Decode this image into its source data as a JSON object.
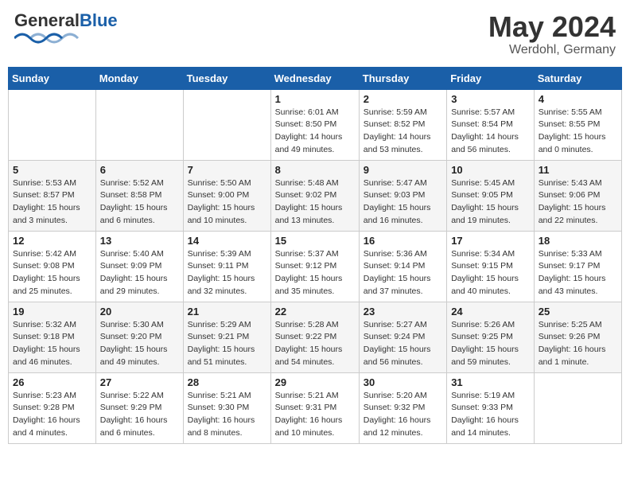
{
  "header": {
    "logo_general": "General",
    "logo_blue": "Blue",
    "month_title": "May 2024",
    "location": "Werdohl, Germany"
  },
  "weekdays": [
    "Sunday",
    "Monday",
    "Tuesday",
    "Wednesday",
    "Thursday",
    "Friday",
    "Saturday"
  ],
  "weeks": [
    [
      {
        "day": "",
        "info": ""
      },
      {
        "day": "",
        "info": ""
      },
      {
        "day": "",
        "info": ""
      },
      {
        "day": "1",
        "info": "Sunrise: 6:01 AM\nSunset: 8:50 PM\nDaylight: 14 hours\nand 49 minutes."
      },
      {
        "day": "2",
        "info": "Sunrise: 5:59 AM\nSunset: 8:52 PM\nDaylight: 14 hours\nand 53 minutes."
      },
      {
        "day": "3",
        "info": "Sunrise: 5:57 AM\nSunset: 8:54 PM\nDaylight: 14 hours\nand 56 minutes."
      },
      {
        "day": "4",
        "info": "Sunrise: 5:55 AM\nSunset: 8:55 PM\nDaylight: 15 hours\nand 0 minutes."
      }
    ],
    [
      {
        "day": "5",
        "info": "Sunrise: 5:53 AM\nSunset: 8:57 PM\nDaylight: 15 hours\nand 3 minutes."
      },
      {
        "day": "6",
        "info": "Sunrise: 5:52 AM\nSunset: 8:58 PM\nDaylight: 15 hours\nand 6 minutes."
      },
      {
        "day": "7",
        "info": "Sunrise: 5:50 AM\nSunset: 9:00 PM\nDaylight: 15 hours\nand 10 minutes."
      },
      {
        "day": "8",
        "info": "Sunrise: 5:48 AM\nSunset: 9:02 PM\nDaylight: 15 hours\nand 13 minutes."
      },
      {
        "day": "9",
        "info": "Sunrise: 5:47 AM\nSunset: 9:03 PM\nDaylight: 15 hours\nand 16 minutes."
      },
      {
        "day": "10",
        "info": "Sunrise: 5:45 AM\nSunset: 9:05 PM\nDaylight: 15 hours\nand 19 minutes."
      },
      {
        "day": "11",
        "info": "Sunrise: 5:43 AM\nSunset: 9:06 PM\nDaylight: 15 hours\nand 22 minutes."
      }
    ],
    [
      {
        "day": "12",
        "info": "Sunrise: 5:42 AM\nSunset: 9:08 PM\nDaylight: 15 hours\nand 25 minutes."
      },
      {
        "day": "13",
        "info": "Sunrise: 5:40 AM\nSunset: 9:09 PM\nDaylight: 15 hours\nand 29 minutes."
      },
      {
        "day": "14",
        "info": "Sunrise: 5:39 AM\nSunset: 9:11 PM\nDaylight: 15 hours\nand 32 minutes."
      },
      {
        "day": "15",
        "info": "Sunrise: 5:37 AM\nSunset: 9:12 PM\nDaylight: 15 hours\nand 35 minutes."
      },
      {
        "day": "16",
        "info": "Sunrise: 5:36 AM\nSunset: 9:14 PM\nDaylight: 15 hours\nand 37 minutes."
      },
      {
        "day": "17",
        "info": "Sunrise: 5:34 AM\nSunset: 9:15 PM\nDaylight: 15 hours\nand 40 minutes."
      },
      {
        "day": "18",
        "info": "Sunrise: 5:33 AM\nSunset: 9:17 PM\nDaylight: 15 hours\nand 43 minutes."
      }
    ],
    [
      {
        "day": "19",
        "info": "Sunrise: 5:32 AM\nSunset: 9:18 PM\nDaylight: 15 hours\nand 46 minutes."
      },
      {
        "day": "20",
        "info": "Sunrise: 5:30 AM\nSunset: 9:20 PM\nDaylight: 15 hours\nand 49 minutes."
      },
      {
        "day": "21",
        "info": "Sunrise: 5:29 AM\nSunset: 9:21 PM\nDaylight: 15 hours\nand 51 minutes."
      },
      {
        "day": "22",
        "info": "Sunrise: 5:28 AM\nSunset: 9:22 PM\nDaylight: 15 hours\nand 54 minutes."
      },
      {
        "day": "23",
        "info": "Sunrise: 5:27 AM\nSunset: 9:24 PM\nDaylight: 15 hours\nand 56 minutes."
      },
      {
        "day": "24",
        "info": "Sunrise: 5:26 AM\nSunset: 9:25 PM\nDaylight: 15 hours\nand 59 minutes."
      },
      {
        "day": "25",
        "info": "Sunrise: 5:25 AM\nSunset: 9:26 PM\nDaylight: 16 hours\nand 1 minute."
      }
    ],
    [
      {
        "day": "26",
        "info": "Sunrise: 5:23 AM\nSunset: 9:28 PM\nDaylight: 16 hours\nand 4 minutes."
      },
      {
        "day": "27",
        "info": "Sunrise: 5:22 AM\nSunset: 9:29 PM\nDaylight: 16 hours\nand 6 minutes."
      },
      {
        "day": "28",
        "info": "Sunrise: 5:21 AM\nSunset: 9:30 PM\nDaylight: 16 hours\nand 8 minutes."
      },
      {
        "day": "29",
        "info": "Sunrise: 5:21 AM\nSunset: 9:31 PM\nDaylight: 16 hours\nand 10 minutes."
      },
      {
        "day": "30",
        "info": "Sunrise: 5:20 AM\nSunset: 9:32 PM\nDaylight: 16 hours\nand 12 minutes."
      },
      {
        "day": "31",
        "info": "Sunrise: 5:19 AM\nSunset: 9:33 PM\nDaylight: 16 hours\nand 14 minutes."
      },
      {
        "day": "",
        "info": ""
      }
    ]
  ]
}
